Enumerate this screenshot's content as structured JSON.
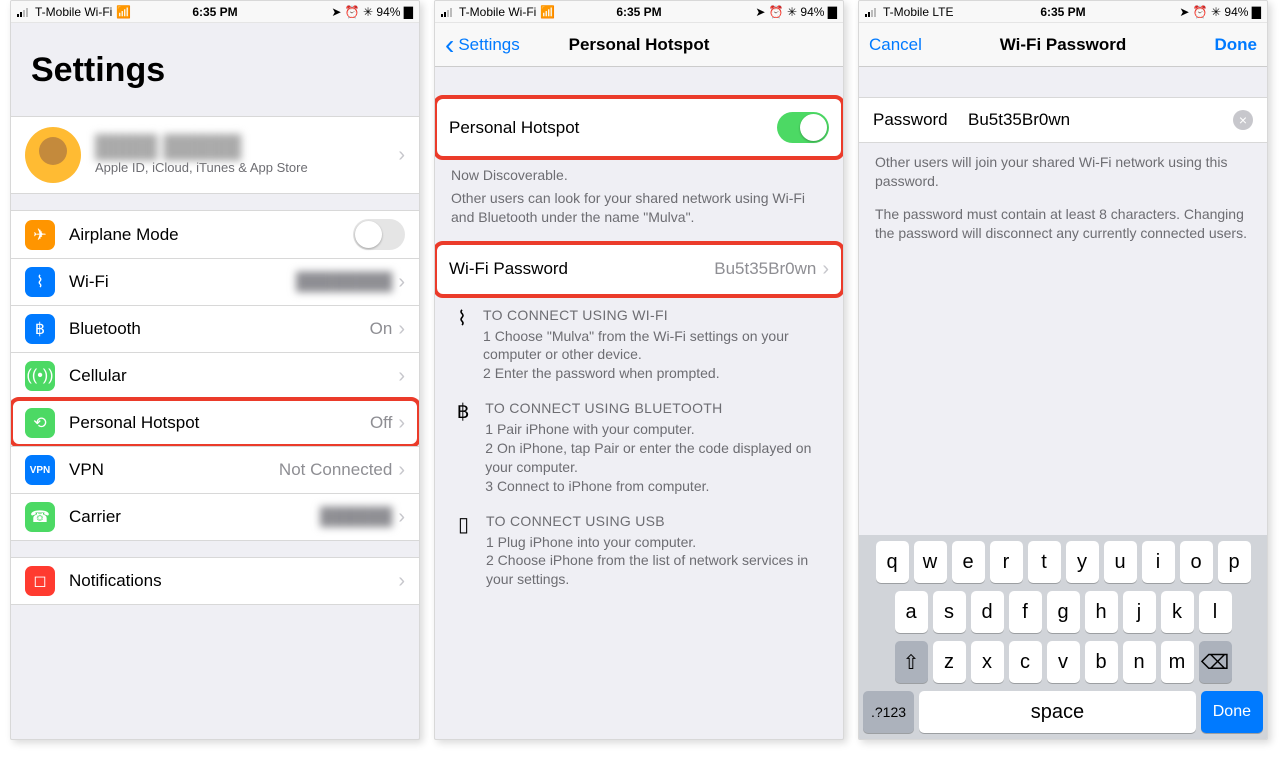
{
  "status": {
    "carrier_wifi": "T-Mobile Wi-Fi",
    "carrier_lte": "T-Mobile  LTE",
    "time": "6:35 PM",
    "right": "94%"
  },
  "screen1": {
    "title": "Settings",
    "profile_sub": "Apple ID, iCloud, iTunes & App Store",
    "rows": {
      "airplane": "Airplane Mode",
      "wifi": "Wi-Fi",
      "bluetooth": "Bluetooth",
      "bluetooth_val": "On",
      "cellular": "Cellular",
      "hotspot": "Personal Hotspot",
      "hotspot_val": "Off",
      "vpn": "VPN",
      "vpn_val": "Not Connected",
      "carrier": "Carrier",
      "notifications": "Notifications"
    }
  },
  "screen2": {
    "back": "Settings",
    "title": "Personal Hotspot",
    "toggle_label": "Personal Hotspot",
    "discoverable": "Now Discoverable.",
    "discoverable_desc": "Other users can look for your shared network using Wi-Fi and Bluetooth under the name \"Mulva\".",
    "wifi_pw_label": "Wi-Fi Password",
    "wifi_pw_value": "Bu5t35Br0wn",
    "wifi_head": "TO CONNECT USING WI-FI",
    "wifi_1": "1 Choose \"Mulva\" from the Wi-Fi settings on your computer or other device.",
    "wifi_2": "2 Enter the password when prompted.",
    "bt_head": "TO CONNECT USING BLUETOOTH",
    "bt_1": "1 Pair iPhone with your computer.",
    "bt_2": "2 On iPhone, tap Pair or enter the code displayed on your computer.",
    "bt_3": "3 Connect to iPhone from computer.",
    "usb_head": "TO CONNECT USING USB",
    "usb_1": "1 Plug iPhone into your computer.",
    "usb_2": "2 Choose iPhone from the list of network services in your settings."
  },
  "screen3": {
    "cancel": "Cancel",
    "title": "Wi-Fi Password",
    "done": "Done",
    "pw_label": "Password",
    "pw_value": "Bu5t35Br0wn",
    "desc1": "Other users will join your shared Wi-Fi network using this password.",
    "desc2": "The password must contain at least 8 characters. Changing the password will disconnect any currently connected users.",
    "keys": {
      "r1": [
        "q",
        "w",
        "e",
        "r",
        "t",
        "y",
        "u",
        "i",
        "o",
        "p"
      ],
      "r2": [
        "a",
        "s",
        "d",
        "f",
        "g",
        "h",
        "j",
        "k",
        "l"
      ],
      "r3": [
        "z",
        "x",
        "c",
        "v",
        "b",
        "n",
        "m"
      ],
      "num": ".?123",
      "space": "space",
      "done": "Done"
    }
  }
}
